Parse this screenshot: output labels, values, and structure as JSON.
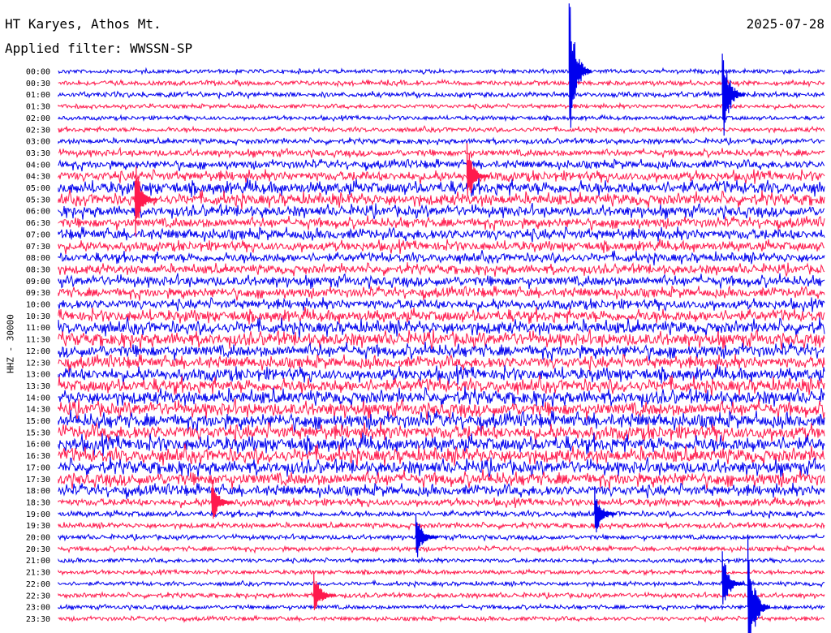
{
  "header": {
    "station": "HT Karyes, Athos Mt.",
    "date": "2025-07-28",
    "filter": "Applied filter: WWSSN-SP",
    "channel_label": "HHZ - 30000"
  },
  "chart_data": {
    "type": "line",
    "title": "HT Karyes, Athos Mt.",
    "subtitle": "Applied filter: WWSSN-SP",
    "ylabel": "HHZ - 30000",
    "colors": {
      "even_rows": "#0000ee",
      "odd_rows": "#ff1a4d"
    },
    "grid": false,
    "legend": "none",
    "y_tick_labels": [
      "00:00",
      "00:30",
      "01:00",
      "01:30",
      "02:00",
      "02:30",
      "03:00",
      "03:30",
      "04:00",
      "04:30",
      "05:00",
      "05:30",
      "06:00",
      "06:30",
      "07:00",
      "07:30",
      "08:00",
      "08:30",
      "09:00",
      "09:30",
      "10:00",
      "10:30",
      "11:00",
      "11:30",
      "12:00",
      "12:30",
      "13:00",
      "13:30",
      "14:00",
      "14:30",
      "15:00",
      "15:30",
      "16:00",
      "16:30",
      "17:00",
      "17:30",
      "18:00",
      "18:30",
      "19:00",
      "19:30",
      "20:00",
      "20:30",
      "21:00",
      "21:30",
      "22:00",
      "22:30",
      "23:00",
      "23:30"
    ],
    "row_activity": [
      0.5,
      0.6,
      0.7,
      0.5,
      0.5,
      0.6,
      0.7,
      1.0,
      1.3,
      1.6,
      2.2,
      2.0,
      1.8,
      1.6,
      1.8,
      1.6,
      1.5,
      1.5,
      1.7,
      1.6,
      1.6,
      2.0,
      2.2,
      2.3,
      2.1,
      2.0,
      2.2,
      2.3,
      2.4,
      2.4,
      2.5,
      2.5,
      2.6,
      2.5,
      2.3,
      2.2,
      1.8,
      1.1,
      0.8,
      0.7,
      0.6,
      0.6,
      0.5,
      0.5,
      0.5,
      0.6,
      0.5,
      0.5
    ],
    "events": [
      {
        "time": "01:00",
        "minute": 26,
        "amplitude": 9
      },
      {
        "time": "00:00",
        "minute": 20,
        "amplitude": 12
      },
      {
        "time": "04:30",
        "minute": 16,
        "amplitude": 5
      },
      {
        "time": "05:30",
        "minute": 3,
        "amplitude": 6
      },
      {
        "time": "22:00",
        "minute": 26,
        "amplitude": 5
      },
      {
        "time": "23:00",
        "minute": 27,
        "amplitude": 11
      },
      {
        "time": "22:30",
        "minute": 10,
        "amplitude": 4
      },
      {
        "time": "19:00",
        "minute": 21,
        "amplitude": 4
      },
      {
        "time": "20:00",
        "minute": 14,
        "amplitude": 4
      },
      {
        "time": "18:30",
        "minute": 6,
        "amplitude": 4
      }
    ]
  }
}
